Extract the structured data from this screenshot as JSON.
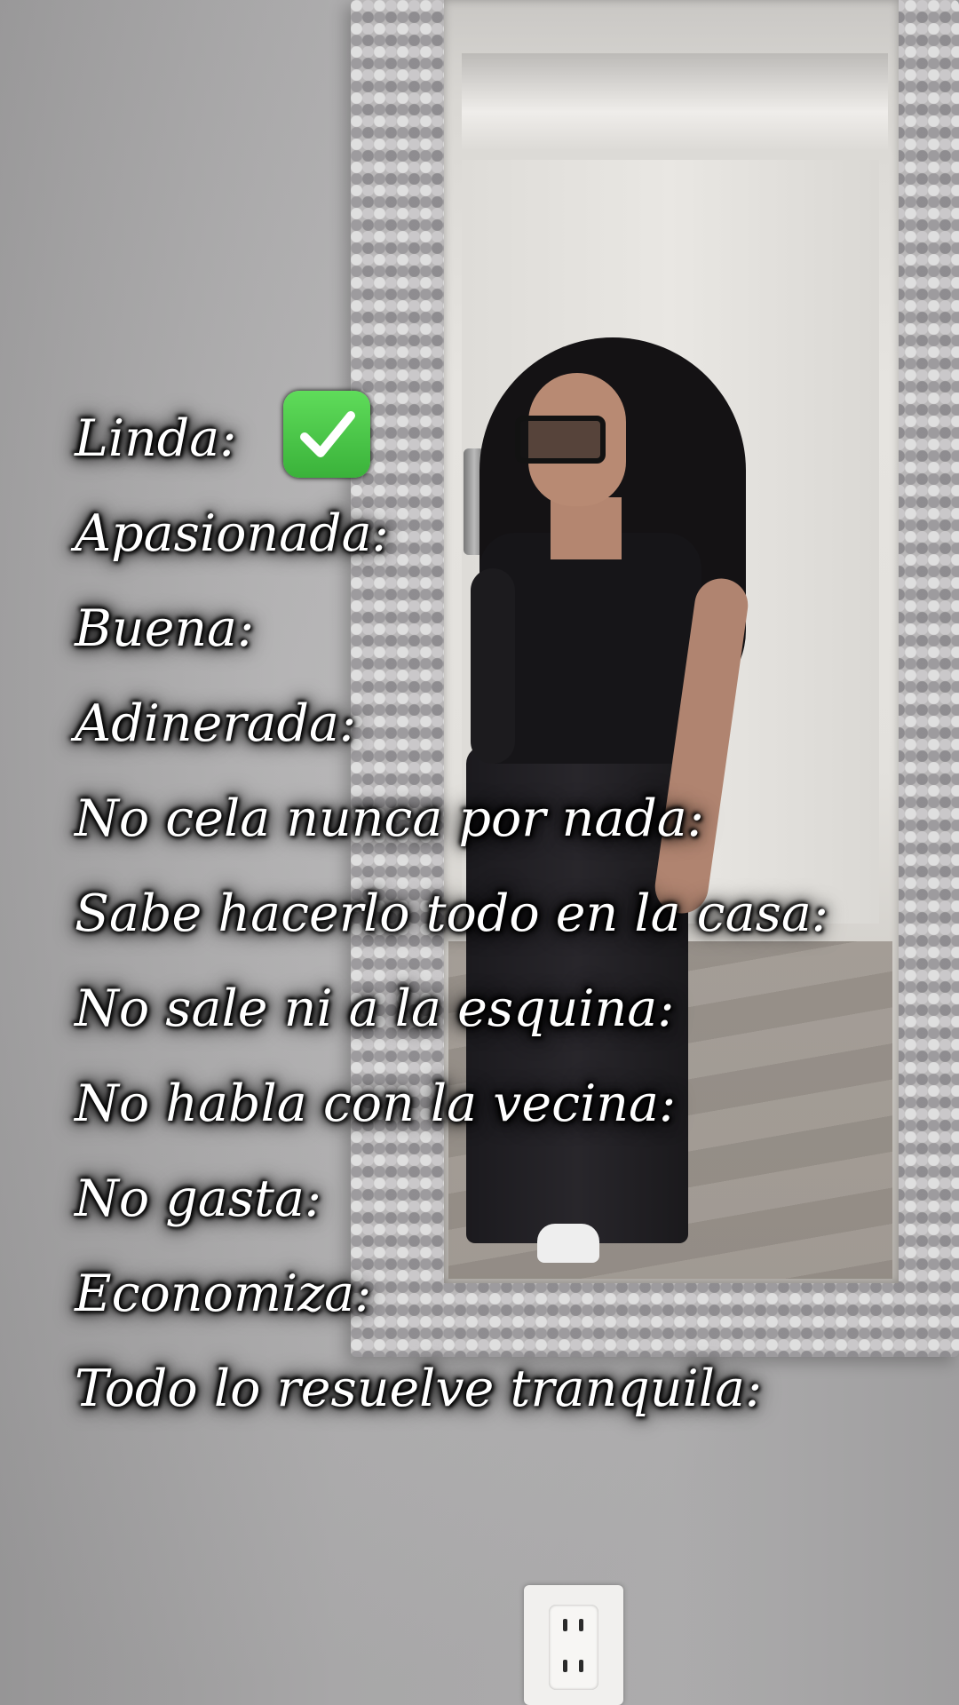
{
  "overlay": {
    "lines": [
      {
        "label": "Linda:",
        "badge": "check-mark-icon"
      },
      {
        "label": "Apasionada:"
      },
      {
        "label": "Buena:"
      },
      {
        "label": "Adinerada:"
      },
      {
        "label": "No cela nunca por nada:"
      },
      {
        "label": "Sabe hacerlo todo en la casa:"
      },
      {
        "label": "No sale ni a la esquina:"
      },
      {
        "label": "No habla con la vecina:"
      },
      {
        "label": "No gasta:"
      },
      {
        "label": "Economiza:"
      },
      {
        "label": "Todo lo resuelve tranquila:"
      }
    ]
  },
  "colors": {
    "text": "#ffffff",
    "text_outline": "#000000",
    "check_badge": "#43c043"
  }
}
